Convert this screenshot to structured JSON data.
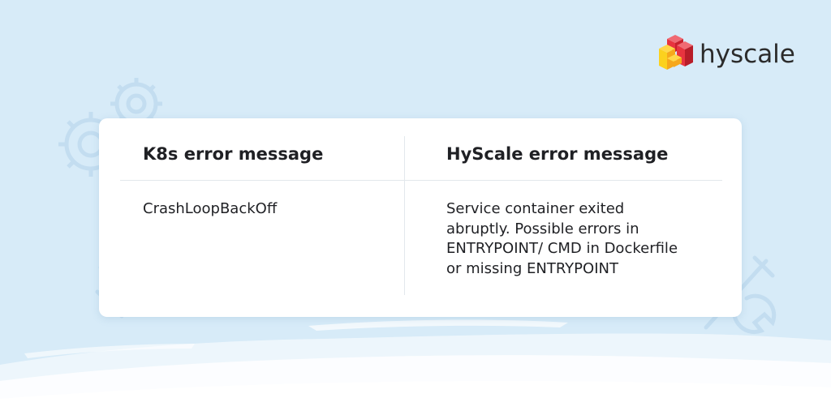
{
  "brand": {
    "name": "hyscale",
    "logo_colors": [
      "#e8343f",
      "#f6a81c",
      "#fbd11e"
    ]
  },
  "background": {
    "color": "#d7ebf8",
    "wave_color": "#ffffff",
    "decorations": [
      "gear-icon",
      "gear-icon",
      "wrench-icon",
      "wrench-icon"
    ]
  },
  "table": {
    "headers": [
      "K8s error message",
      "HyScale error message"
    ],
    "rows": [
      {
        "k8s": "CrashLoopBackOff",
        "hyscale_lines": [
          "Service container exited",
          "abruptly. Possible errors in",
          "ENTRYPOINT/ CMD in Dockerfile",
          "or missing ENTRYPOINT"
        ]
      }
    ]
  }
}
